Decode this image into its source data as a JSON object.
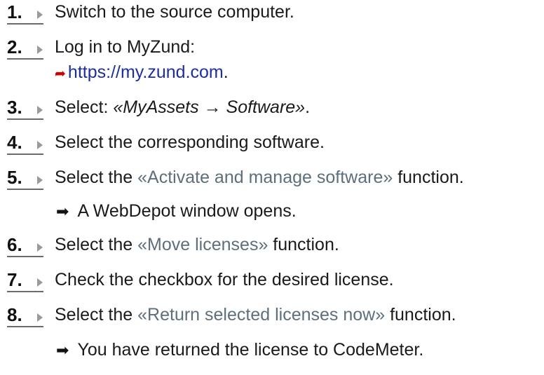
{
  "steps": [
    {
      "number": "1.",
      "text": "Switch to the source computer."
    },
    {
      "number": "2.",
      "text": "Log in to MyZund:",
      "link_icon": "➦",
      "link_text": "https://my.zund.com",
      "link_suffix": "."
    },
    {
      "number": "3.",
      "prefix": "Select: ",
      "path": "«MyAssets → Software»",
      "suffix": "."
    },
    {
      "number": "4.",
      "text": "Select the corresponding software."
    },
    {
      "number": "5.",
      "prefix": "Select the ",
      "function": "«Activate and manage software»",
      "suffix": " function."
    },
    {
      "number": "6.",
      "prefix": "Select the ",
      "function": "«Move licenses»",
      "suffix": " function."
    },
    {
      "number": "7.",
      "text": "Check the checkbox for the desired license."
    },
    {
      "number": "8.",
      "prefix": "Select the ",
      "function": "«Return selected licenses now»",
      "suffix": " function."
    }
  ],
  "results": [
    {
      "icon": "➡",
      "text": "A WebDepot window opens."
    },
    {
      "icon": "➡",
      "text": "You have returned the license to CodeMeter."
    }
  ]
}
